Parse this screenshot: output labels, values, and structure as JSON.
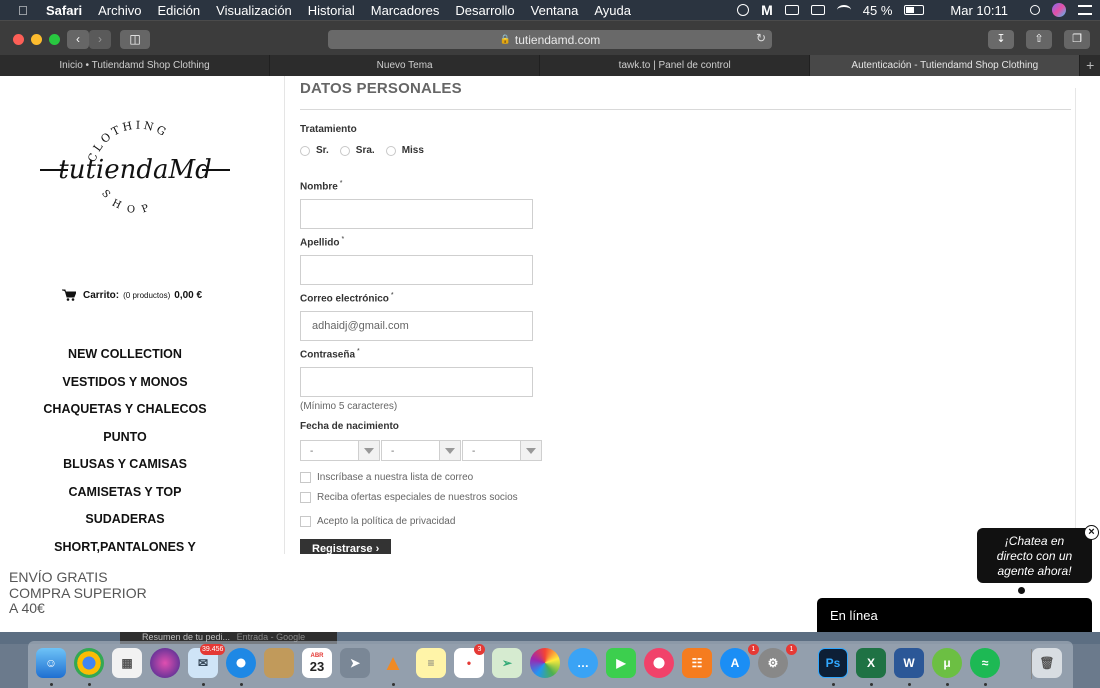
{
  "menubar": {
    "items": [
      "Safari",
      "Archivo",
      "Edición",
      "Visualización",
      "Historial",
      "Marcadores",
      "Desarrollo",
      "Ventana",
      "Ayuda"
    ],
    "battery": "45 %",
    "clock": "Mar 10:11"
  },
  "toolbar": {
    "url": "tutiendamd.com"
  },
  "tabs": [
    {
      "label": "Inicio • Tutiendamd Shop Clothing",
      "active": false
    },
    {
      "label": "Nuevo Tema",
      "active": false
    },
    {
      "label": "tawk.to | Panel de control",
      "active": false
    },
    {
      "label": "Autenticación - Tutiendamd Shop Clothing",
      "active": true
    }
  ],
  "logo": {
    "top": "CLOTHING",
    "name": "tutiendaMd",
    "bottom": "SHOP"
  },
  "cart": {
    "label": "Carrito:",
    "count": "(0 productos)",
    "total": "0,00 €"
  },
  "menu": {
    "items": [
      "NEW COLLECTION",
      "VESTIDOS Y MONOS",
      "CHAQUETAS Y CHALECOS",
      "PUNTO",
      "BLUSAS Y CAMISAS",
      "CAMISETAS Y TOP",
      "SUDADERAS",
      "SHORT,PANTALONES Y"
    ]
  },
  "promo": {
    "line1": "ENVÍO GRATIS",
    "line2": "COMPRA SUPERIOR",
    "line3": "A 40€"
  },
  "form": {
    "section_title": "DATOS PERSONALES",
    "tratamiento_label": "Tratamiento",
    "radios": [
      "Sr.",
      "Sra.",
      "Miss"
    ],
    "nombre_label": "Nombre",
    "apellido_label": "Apellido",
    "email_label": "Correo electrónico",
    "email_value": "adhaidj@gmail.com",
    "password_label": "Contraseña",
    "password_hint": "(Mínimo 5 caracteres)",
    "birth_label": "Fecha de nacimiento",
    "birth_selects": [
      "-",
      "-",
      "-"
    ],
    "required_mark": "*",
    "checkboxes": [
      "Inscríbase a nuestra lista de correo",
      "Reciba ofertas especiales de nuestros socios",
      "Acepto la política de privacidad"
    ],
    "submit_label": "Registrarse"
  },
  "chat": {
    "bubble_line1": "¡Chatea en",
    "bubble_line2": "directo con un",
    "bubble_line3": "agente ahora!",
    "status": "En línea"
  },
  "background_window": {
    "title": "Resumen de tu pedi...",
    "subtitle": "Entrada - Google"
  },
  "dock": {
    "badges": {
      "mail": "39.456",
      "reminders": "3",
      "appstore": "1",
      "prefs": "1"
    },
    "calendar_day": "23",
    "calendar_month": "ABR"
  }
}
